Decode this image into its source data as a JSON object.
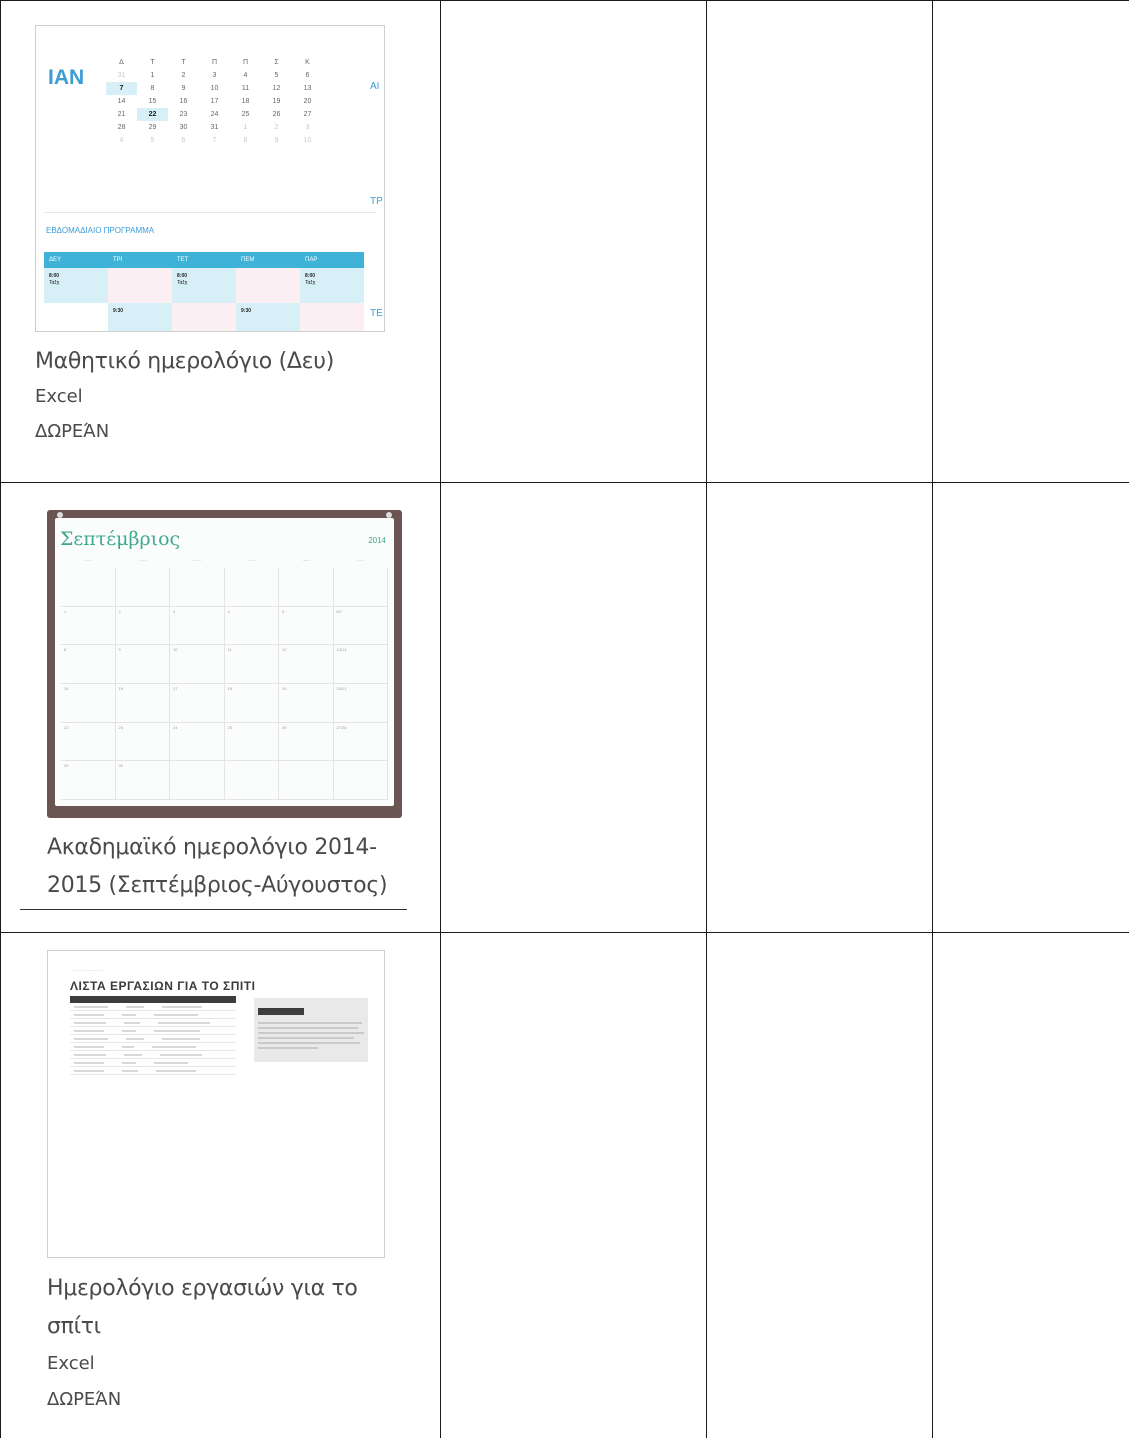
{
  "templates": [
    {
      "title": "Μαθητικό ημερολόγιο (Δευ)",
      "app": "Excel",
      "price": "ΔΩΡΕΆΝ",
      "thumbnail": {
        "month": "ΙΑΝ",
        "side_labels": [
          "ΑΙ",
          "ΤΡ",
          "ΤΕ"
        ],
        "day_headers": [
          "Δ",
          "Τ",
          "Τ",
          "Π",
          "Π",
          "Σ",
          "Κ"
        ],
        "weeks": [
          [
            "31",
            "1",
            "2",
            "3",
            "4",
            "5",
            "6"
          ],
          [
            "7",
            "8",
            "9",
            "10",
            "11",
            "12",
            "13"
          ],
          [
            "14",
            "15",
            "16",
            "17",
            "18",
            "19",
            "20"
          ],
          [
            "21",
            "22",
            "23",
            "24",
            "25",
            "26",
            "27"
          ],
          [
            "28",
            "29",
            "30",
            "31",
            "1",
            "2",
            "3"
          ],
          [
            "4",
            "5",
            "6",
            "7",
            "8",
            "9",
            "10"
          ]
        ],
        "schedule_title": "ΕΒΔΟΜΑΔΙΑΙΟ ΠΡΟΓΡΑΜΜΑ",
        "schedule_days": [
          "ΔΕΥ",
          "ΤΡΙ",
          "ΤΕΤ",
          "ΠΕΜ",
          "ΠΑΡ"
        ],
        "schedule_entries": [
          {
            "time": "8:00",
            "label": "Τάξη"
          },
          {
            "time": "",
            "label": ""
          },
          {
            "time": "8:00",
            "label": "Τάξη"
          },
          {
            "time": "",
            "label": ""
          },
          {
            "time": "8:00",
            "label": "Τάξη"
          },
          {
            "time": "",
            "label": ""
          },
          {
            "time": "9:30",
            "label": ""
          },
          {
            "time": "",
            "label": ""
          },
          {
            "time": "9:30",
            "label": ""
          },
          {
            "time": "",
            "label": ""
          }
        ]
      }
    },
    {
      "title_line1": "Ακαδημαϊκό ημερολόγιο 2014-",
      "title_line2": "2015 (Σεπτέμβριος-Αύγουστος)",
      "thumbnail": {
        "month": "Σεπτέμβριος",
        "year": "2014",
        "cells": [
          "",
          "",
          "",
          "",
          "",
          "",
          "1",
          "2",
          "3",
          "4",
          "5",
          "6/7",
          "8",
          "9",
          "10",
          "11",
          "12",
          "13/14",
          "15",
          "16",
          "17",
          "18",
          "19",
          "20/21",
          "22",
          "23",
          "24",
          "25",
          "26",
          "27/28",
          "29",
          "30",
          "",
          "",
          "",
          ""
        ]
      }
    },
    {
      "title_line1": "Ημερολόγιο εργασιών για το",
      "title_line2": "σπίτι",
      "app": "Excel",
      "price": "ΔΩΡΕΆΝ",
      "thumbnail": {
        "title": "ΛΙΣΤΑ ΕΡΓΑΣΙΩΝ ΓΙΑ ΤΟ ΣΠΙΤΙ"
      }
    }
  ]
}
